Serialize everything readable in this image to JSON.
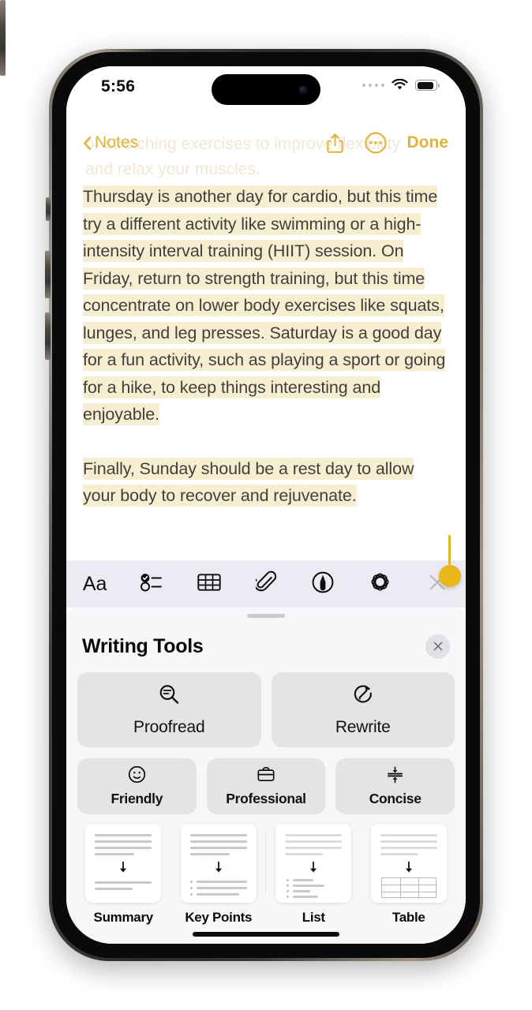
{
  "status_bar": {
    "time": "5:56",
    "cellular_icon": "cellular-dots-icon",
    "wifi_icon": "wifi-icon",
    "battery_icon": "battery-icon"
  },
  "nav_bar": {
    "back_label": "Notes",
    "back_icon": "chevron-left-icon",
    "share_icon": "share-icon",
    "more_icon": "ellipsis-circle-icon",
    "done_label": "Done"
  },
  "note": {
    "ghost_line_1": "or stretching exercises to improve flexibility",
    "ghost_line_2": "and relax your muscles.",
    "paragraph_1": "Thursday is another day for cardio, but this time try a different activity like swimming or a high-intensity interval training (HIIT) session. On Friday, return to strength training, but this time concentrate on lower body exercises like squats, lunges, and leg presses. Saturday is a good day for a fun activity, such as playing a sport or going for a hike, to keep things interesting and enjoyable.",
    "paragraph_2": "Finally, Sunday should be a rest day to allow your body to recover and rejuvenate.",
    "highlight_color": "#f7eed2",
    "caret_color": "#e9b71c"
  },
  "format_toolbar": {
    "items": [
      {
        "name": "format-text",
        "label": "Aa",
        "icon": "aa-icon"
      },
      {
        "name": "checklist",
        "label": "",
        "icon": "checklist-icon"
      },
      {
        "name": "table",
        "label": "",
        "icon": "table-icon"
      },
      {
        "name": "attachment",
        "label": "",
        "icon": "paperclip-icon"
      },
      {
        "name": "markup",
        "label": "",
        "icon": "markup-pen-icon"
      },
      {
        "name": "apple-intelligence",
        "label": "",
        "icon": "apple-intelligence-icon"
      },
      {
        "name": "close-toolbar",
        "label": "",
        "icon": "close-x-icon"
      }
    ]
  },
  "writing_tools": {
    "title": "Writing Tools",
    "close_icon": "close-icon",
    "primary_actions": [
      {
        "label": "Proofread",
        "icon": "proofread-magnifier-icon"
      },
      {
        "label": "Rewrite",
        "icon": "rewrite-circular-arrow-icon"
      }
    ],
    "tone_actions": [
      {
        "label": "Friendly",
        "icon": "smiley-face-icon"
      },
      {
        "label": "Professional",
        "icon": "briefcase-icon"
      },
      {
        "label": "Concise",
        "icon": "compress-arrows-icon"
      }
    ],
    "transform_actions": [
      {
        "label": "Summary",
        "icon": "summary-doc-icon"
      },
      {
        "label": "Key Points",
        "icon": "key-points-doc-icon"
      },
      {
        "label": "List",
        "icon": "list-doc-icon"
      },
      {
        "label": "Table",
        "icon": "table-doc-icon"
      }
    ]
  },
  "accent_color": "#e0b43a"
}
